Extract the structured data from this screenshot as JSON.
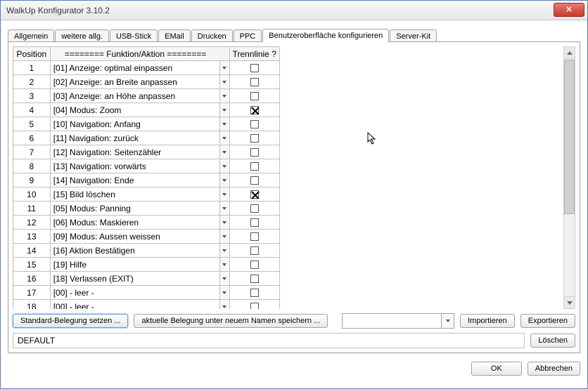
{
  "window": {
    "title": "WalkUp Konfigurator 3.10.2"
  },
  "tabs": [
    {
      "label": "Allgemein",
      "active": false
    },
    {
      "label": "weitere allg.",
      "active": false
    },
    {
      "label": "USB-Stick",
      "active": false
    },
    {
      "label": "EMail",
      "active": false
    },
    {
      "label": "Drucken",
      "active": false
    },
    {
      "label": "PPC",
      "active": false
    },
    {
      "label": "Benutzeroberfläche konfigurieren",
      "active": true
    },
    {
      "label": "Server-Kit",
      "active": false
    }
  ],
  "table": {
    "headers": {
      "position": "Position",
      "function": "======== Funktion/Aktion ========",
      "separator": "Trennlinie ?"
    },
    "rows": [
      {
        "pos": "1",
        "func": "[01] Anzeige: optimal einpassen",
        "sep": false
      },
      {
        "pos": "2",
        "func": "[02] Anzeige: an Breite anpassen",
        "sep": false
      },
      {
        "pos": "3",
        "func": "[03] Anzeige: an Höhe anpassen",
        "sep": false
      },
      {
        "pos": "4",
        "func": "[04] Modus: Zoom",
        "sep": true
      },
      {
        "pos": "5",
        "func": "[10] Navigation: Anfang",
        "sep": false
      },
      {
        "pos": "6",
        "func": "[11] Navigation: zurück",
        "sep": false
      },
      {
        "pos": "7",
        "func": "[12] Navigation: Seitenzähler",
        "sep": false
      },
      {
        "pos": "8",
        "func": "[13] Navigation: vorwärts",
        "sep": false
      },
      {
        "pos": "9",
        "func": "[14] Navigation: Ende",
        "sep": false
      },
      {
        "pos": "10",
        "func": "[15] Bild löschen",
        "sep": true
      },
      {
        "pos": "11",
        "func": "[05] Modus: Panning",
        "sep": false
      },
      {
        "pos": "12",
        "func": "[06] Modus: Maskieren",
        "sep": false
      },
      {
        "pos": "13",
        "func": "[09] Modus: Aussen weissen",
        "sep": false
      },
      {
        "pos": "14",
        "func": "[16] Aktion Bestätigen",
        "sep": false
      },
      {
        "pos": "15",
        "func": "[19] Hilfe",
        "sep": false
      },
      {
        "pos": "16",
        "func": "[18] Verlassen (EXIT)",
        "sep": false
      },
      {
        "pos": "17",
        "func": "[00] - leer -",
        "sep": false
      },
      {
        "pos": "18",
        "func": "[00] - leer -",
        "sep": false
      }
    ]
  },
  "buttons": {
    "set_default": "Standard-Belegung setzen ...",
    "save_as": "aktuelle Belegung unter neuem Namen speichern ...",
    "import": "Importieren",
    "export": "Exportieren",
    "delete": "Löschen",
    "ok": "OK",
    "cancel": "Abbrechen"
  },
  "combo": {
    "selected": ""
  },
  "status": {
    "text": "DEFAULT"
  }
}
